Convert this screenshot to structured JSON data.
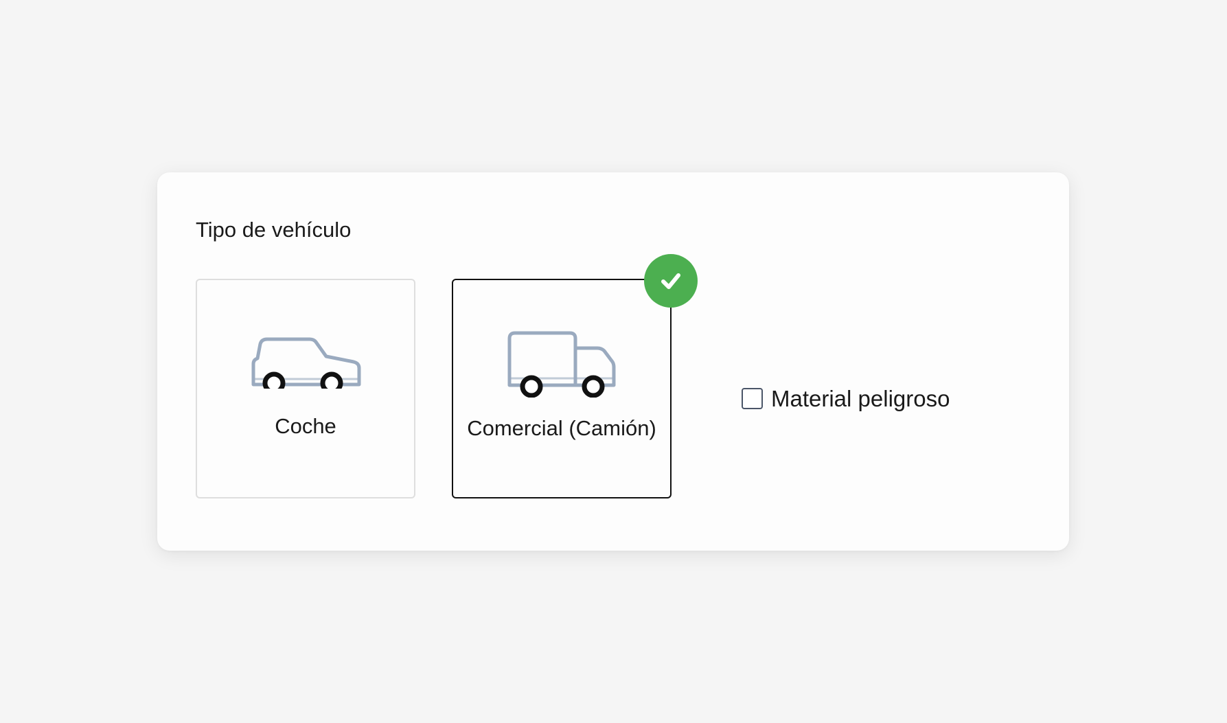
{
  "form": {
    "section_title": "Tipo de vehículo",
    "options": [
      {
        "label": "Coche",
        "icon": "car-icon",
        "selected": false
      },
      {
        "label": "Comercial (Camión)",
        "icon": "truck-icon",
        "selected": true
      }
    ],
    "selected_badge_icon": "checkmark-icon",
    "hazardous_checkbox": {
      "label": "Material peligroso",
      "checked": false
    }
  },
  "colors": {
    "background": "#f5f5f5",
    "card": "#fdfdfd",
    "selected_border": "#111111",
    "unselected_border": "#dedede",
    "badge": "#4caf50",
    "icon_body": "#9aaabf",
    "icon_wheel": "#111111"
  }
}
